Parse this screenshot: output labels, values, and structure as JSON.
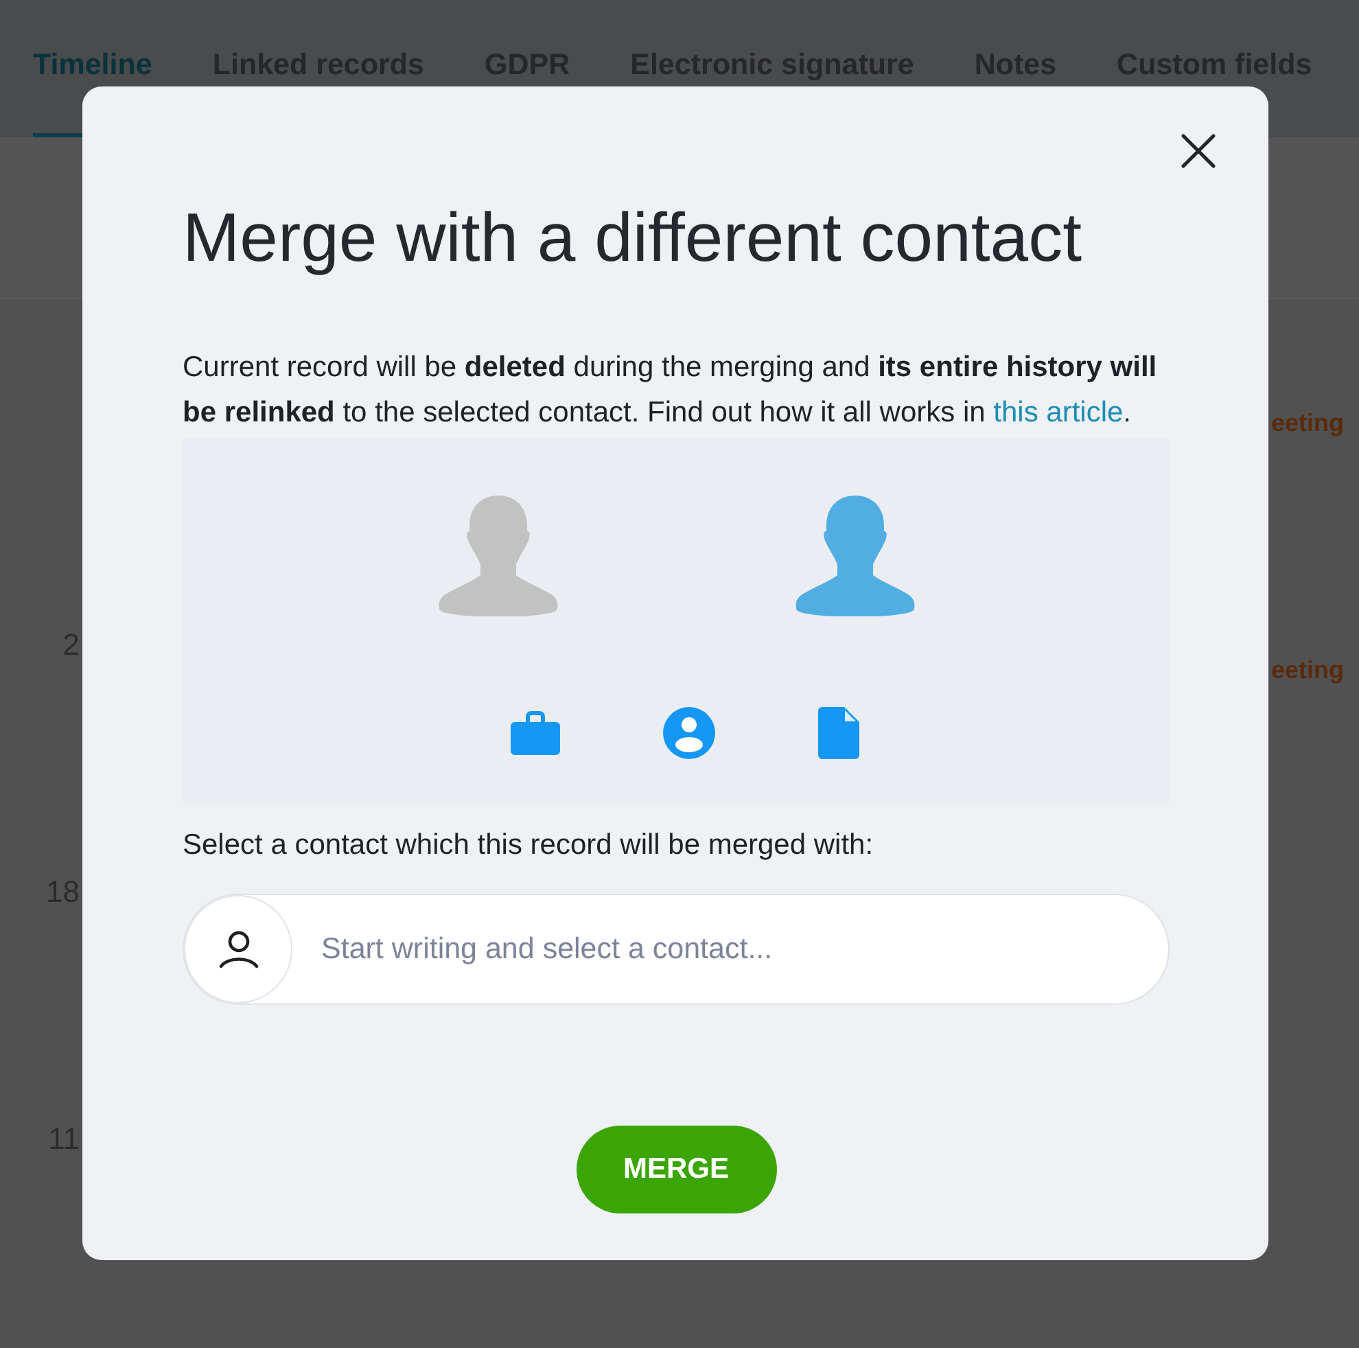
{
  "tabs": [
    {
      "label": "Timeline",
      "selected": true
    },
    {
      "label": "Linked records",
      "selected": false
    },
    {
      "label": "GDPR",
      "selected": false
    },
    {
      "label": "Electronic signature",
      "selected": false
    },
    {
      "label": "Notes",
      "selected": false
    },
    {
      "label": "Custom fields",
      "selected": false
    }
  ],
  "background_rows": [
    {
      "tag": "eeting"
    },
    {
      "label": "2",
      "tag": "eeting"
    },
    {
      "label": "18"
    },
    {
      "label": "11"
    }
  ],
  "dialog": {
    "title": "Merge with a different contact",
    "intro": {
      "text": "Current record will be **deleted** during the merging and **its entire history will be relinked** to the selected contact. Find out how it all works in ",
      "link": "this article",
      "tail": "."
    },
    "prompt": "Select a contact which this record will be merged with:",
    "contact_field": {
      "placeholder": "Start writing and select a contact..."
    },
    "merge_button": "MERGE"
  }
}
